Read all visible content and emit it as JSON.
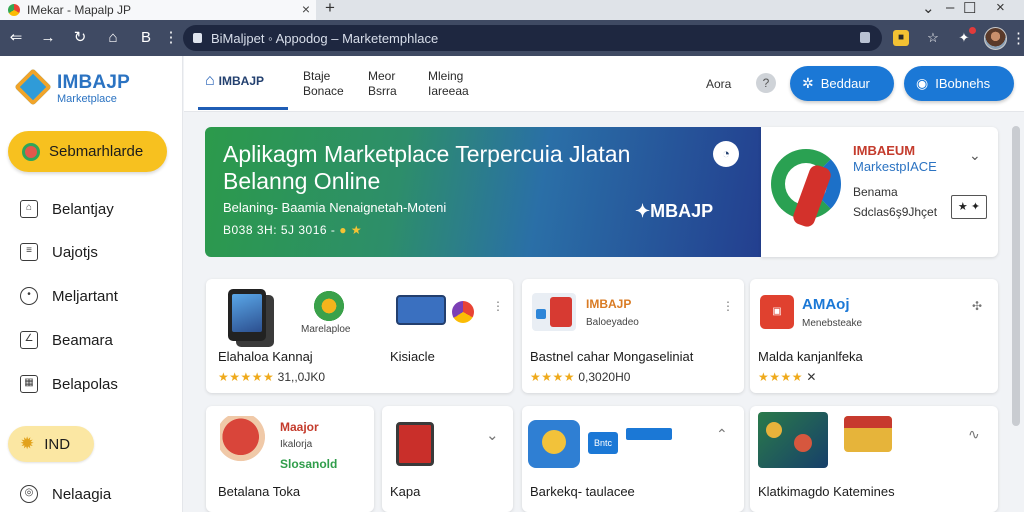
{
  "browser": {
    "tab_title": "IMekar - Mapalp JP",
    "url": "BiMaljpet ◦ Appodog – Marketemphlace"
  },
  "sidebar": {
    "logo_title": "IMBAJP",
    "logo_sub": "Marketplace",
    "primary_button": "Sebmarhlarde",
    "items": [
      {
        "label": "Belantjay",
        "icon": "bag-icon"
      },
      {
        "label": "Uajotjs",
        "icon": "list-icon"
      },
      {
        "label": "Meljartant",
        "icon": "pin-icon"
      },
      {
        "label": "Beamara",
        "icon": "chart-icon"
      },
      {
        "label": "Belapolas",
        "icon": "store-icon"
      }
    ],
    "help_button": "IND",
    "footer_item": "Nelaagia"
  },
  "topnav": {
    "home": "IMBAJP",
    "links": [
      {
        "line1": "Btaje",
        "line2": "Bonace"
      },
      {
        "line1": "Meor",
        "line2": "Bsrra"
      },
      {
        "line1": "Mleing",
        "line2": "Iareeaa"
      }
    ],
    "user": "Aora",
    "help": "?",
    "buttons": [
      {
        "label": "Beddaur",
        "icon": "settings-icon"
      },
      {
        "label": "IBobnehs",
        "icon": "user-icon"
      }
    ]
  },
  "hero": {
    "title": "Aplikagm Marketplace Terpercuia Jlatan Belanng Online",
    "subtitle": "Belaning- Baamia Nenaignetah-Moteni",
    "stats": "B038 3H: 5J 3016 -",
    "brand": "MBAJP"
  },
  "promo": {
    "title": "IMBAEUM",
    "subtitle": "MarkestpIACE",
    "line1": "Benama",
    "line2": "Sdclas6ş9Jhçet",
    "action": "★ ✦"
  },
  "cards": [
    {
      "name": "Elahaloa Kannaj",
      "rating": "31,,0JK0",
      "small": "Marelaploe",
      "extra": "Kisiacle"
    },
    {
      "name": "Bastnel cahar Mongaseliniat",
      "rating": "0,3020H0",
      "brand": "IMBAJP",
      "small": "Baloeyadeo"
    },
    {
      "name": "Malda kanjanlfeka",
      "rating": "✕",
      "brand": "AMAoj",
      "small": "Menebsteake"
    },
    {
      "name": "Betalana Toka",
      "brand": "Maajor",
      "small": "Ikalorja",
      "extra": "Slosanold"
    },
    {
      "name": "Kapa"
    },
    {
      "name": "Barkekq- taulacee",
      "small": "Bntc"
    },
    {
      "name": "Klatkimagdo Katemines"
    }
  ],
  "colors": {
    "primary_blue": "#1b78d6",
    "accent_yellow": "#f7c11f",
    "star": "#efaa1c",
    "chrome_toolbar": "#3f4a63"
  }
}
